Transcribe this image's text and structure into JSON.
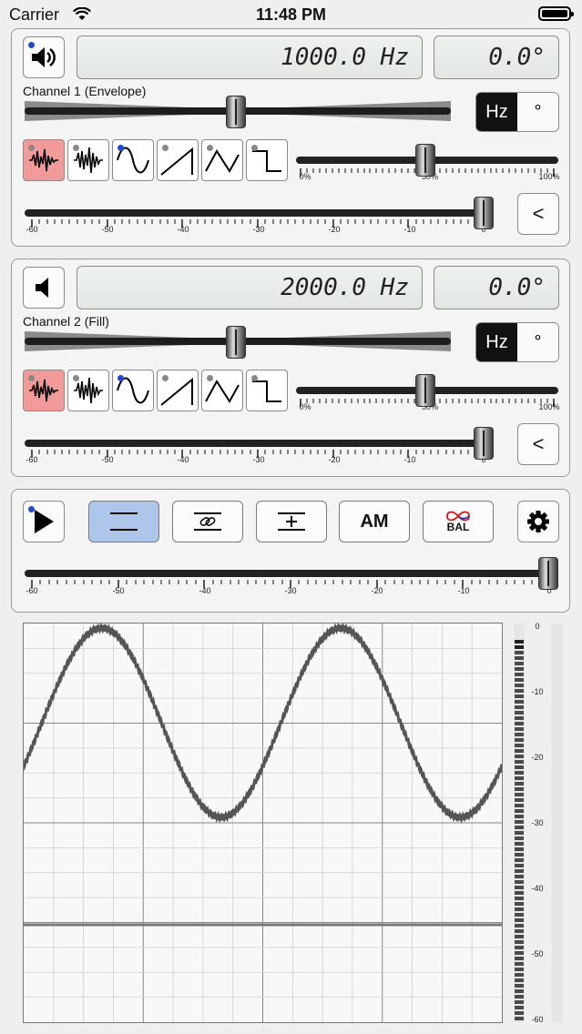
{
  "status": {
    "carrier": "Carrier",
    "time": "11:48 PM"
  },
  "channel1": {
    "label": "Channel 1 (Envelope)",
    "frequency": "1000.0 Hz",
    "phase": "0.0°",
    "unit_hz": "Hz",
    "unit_deg": "°",
    "speaker_icon": "speaker-on-icon",
    "selected_wave": "noise-pink",
    "duty_scale": [
      "0%",
      "50%",
      "100%"
    ],
    "duty_value": 0.5,
    "level_scale": [
      "-60",
      "-50",
      "-40",
      "-30",
      "-20",
      "-10",
      "0"
    ],
    "level_value": 0,
    "back_label": "<"
  },
  "channel2": {
    "label": "Channel 2 (Fill)",
    "frequency": "2000.0 Hz",
    "phase": "0.0°",
    "unit_hz": "Hz",
    "unit_deg": "°",
    "speaker_icon": "speaker-muted-icon",
    "selected_wave": "noise-pink",
    "duty_scale": [
      "0%",
      "50%",
      "100%"
    ],
    "duty_value": 0.5,
    "level_scale": [
      "-60",
      "-50",
      "-40",
      "-30",
      "-20",
      "-10",
      "0"
    ],
    "level_value": 0,
    "back_label": "<"
  },
  "master": {
    "am_label": "AM",
    "bal_label": "BAL",
    "level_scale": [
      "-60",
      "-50",
      "-40",
      "-30",
      "-20",
      "-10",
      "0"
    ],
    "level_value": 0
  },
  "meter": {
    "labels": [
      "0",
      "-10",
      "-20",
      "-30",
      "-40",
      "-50",
      "-60"
    ]
  },
  "colors": {
    "selected_wave": "#f29a9a",
    "active_mode": "#aec6ea",
    "indicator": "#1a4bd6"
  }
}
